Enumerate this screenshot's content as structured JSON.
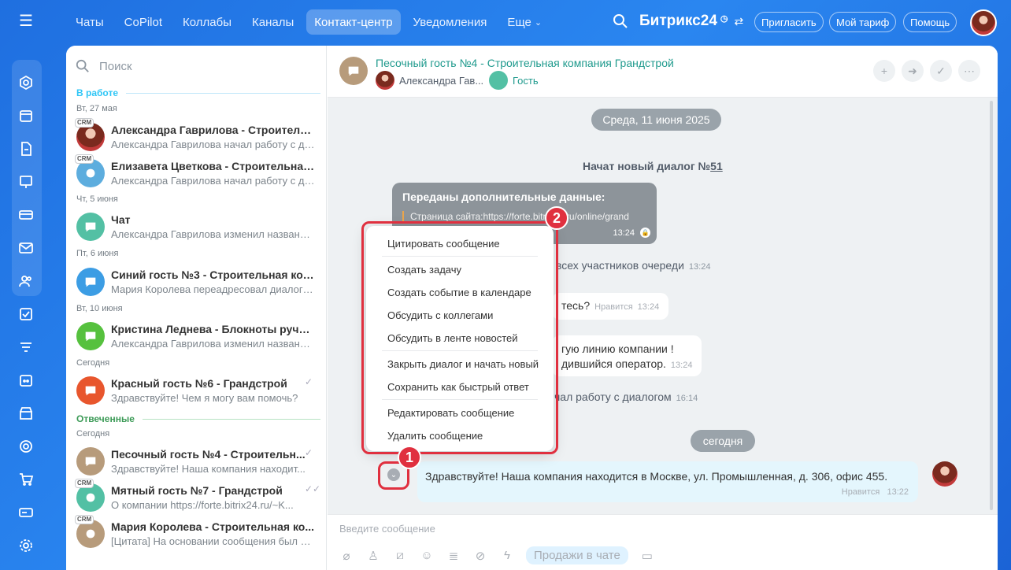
{
  "topnav": {
    "tabs": [
      "Чаты",
      "CoPilot",
      "Коллабы",
      "Каналы",
      "Контакт-центр",
      "Уведомления",
      "Еще"
    ],
    "brand": "Битрикс24",
    "invite": "Пригласить",
    "tariff": "Мой тариф",
    "help": "Помощь"
  },
  "sidebar": {
    "search_placeholder": "Поиск",
    "section_work": "В работе",
    "section_answered": "Отвеченные",
    "dates": [
      "Вт, 27 мая",
      "Чт, 5 июня",
      "Пт, 6 июня",
      "Вт, 10 июня",
      "Сегодня",
      "Сегодня"
    ],
    "items": [
      {
        "title": "Александра Гаврилова - Строительн...",
        "sub": "Александра Гаврилова начал работу с ди...",
        "crm": "CRM"
      },
      {
        "title": "Елизавета Цветкова - Строительная ...",
        "sub": "Александра Гаврилова начал работу с ди...",
        "crm": "CRM"
      },
      {
        "title": "Чат",
        "sub": "Александра Гаврилова изменил название..."
      },
      {
        "title": "Синий гость №3 - Строительная комп...",
        "sub": "Мария Королева переадресовал диалог н..."
      },
      {
        "title": "Кристина Леднева - Блокноты ручно...",
        "sub": "Александра Гаврилова изменил название..."
      },
      {
        "title": "Красный гость №6 - Грандстрой",
        "sub": "Здравствуйте! Чем я могу вам помочь?"
      },
      {
        "title": "Песочный гость №4 - Строительн...",
        "sub": "Здравствуйте! Наша компания находит..."
      },
      {
        "title": "Мятный гость №7 - Грандстрой",
        "sub": "О компании https://forte.bitrix24.ru/~K...",
        "crm": "CRM"
      },
      {
        "title": "Мария Королева - Строительная ко...",
        "sub": "[Цитата] На основании сообщения был со...",
        "crm": "CRM"
      }
    ]
  },
  "chat": {
    "title": "Песочный гость №4 - Строительная компания Грандстрой",
    "member1": "Александра Гав...",
    "member2": "Гость",
    "date_pill": "Среда, 11 июня 2025",
    "new_dialog_prefix": "Начат новый диалог №",
    "new_dialog_num": "51",
    "ext_header": "Переданы дополнительные данные:",
    "ext_line": "Страница сайта:https://forte.bitrix24.ru/online/grand",
    "ext_time": "13:24",
    "sys1": "всех участников очереди",
    "sys1_time": "13:24",
    "msg_q": "тесь?",
    "like": "Нравится",
    "msg_q_time": "13:24",
    "msg_line1": "гую линию компании !",
    "msg_line2": "дившийся оператор.",
    "msg_line_time": "13:24",
    "sys2": "чал работу с диалогом",
    "sys2_time": "16:14",
    "today_pill": "сегодня",
    "mine_text": "Здравствуйте! Наша компания находится в Москве, ул. Промышленная, д. 306, офис 455.",
    "mine_like": "Нравится",
    "mine_time": "13:22",
    "input_placeholder": "Введите сообщение",
    "sales_chip": "Продажи в чате"
  },
  "menu": {
    "items": [
      "Цитировать сообщение",
      "Создать задачу",
      "Создать событие в календаре",
      "Обсудить с коллегами",
      "Обсудить в ленте новостей",
      "Закрыть диалог и начать новый",
      "Сохранить как быстрый ответ",
      "Редактировать сообщение",
      "Удалить сообщение"
    ]
  },
  "badges": {
    "one": "1",
    "two": "2"
  },
  "colors": {
    "accent_red": "#e0303f",
    "brand_blue": "#2a86f0",
    "guest_sand": "#b79b7b"
  }
}
